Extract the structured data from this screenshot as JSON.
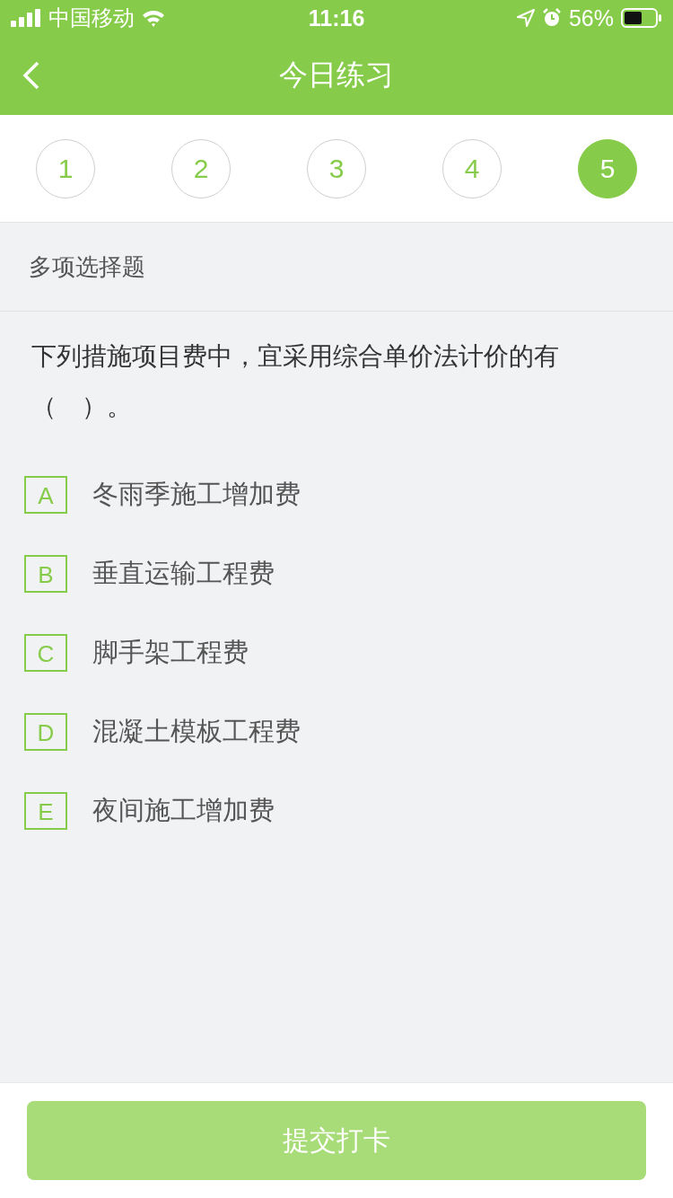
{
  "status_bar": {
    "carrier": "中国移动",
    "time": "11:16",
    "battery": "56%"
  },
  "nav": {
    "title": "今日练习"
  },
  "steps": [
    {
      "label": "1",
      "selected": false
    },
    {
      "label": "2",
      "selected": false
    },
    {
      "label": "3",
      "selected": false
    },
    {
      "label": "4",
      "selected": false
    },
    {
      "label": "5",
      "selected": true
    }
  ],
  "question": {
    "type": "多项选择题",
    "text": "下列措施项目费中，宜采用综合单价法计价的有（　）。",
    "options": [
      {
        "letter": "A",
        "text": "冬雨季施工增加费",
        "selected": false
      },
      {
        "letter": "B",
        "text": "垂直运输工程费",
        "selected": false
      },
      {
        "letter": "C",
        "text": "脚手架工程费",
        "selected": false
      },
      {
        "letter": "D",
        "text": "混凝土模板工程费",
        "selected": false
      },
      {
        "letter": "E",
        "text": "夜间施工增加费",
        "selected": false
      }
    ]
  },
  "submit": {
    "label": "提交打卡",
    "disabled": true
  }
}
